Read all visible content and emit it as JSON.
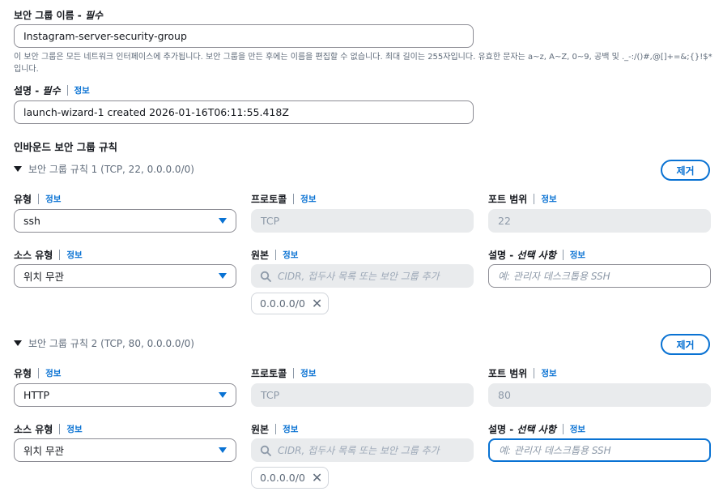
{
  "sg_name": {
    "label": "보안 그룹 이름 - ",
    "required": "필수",
    "value": "Instagram-server-security-group",
    "hint": "이 보안 그룹은 모든 네트워크 인터페이스에 추가됩니다. 보안 그룹을 만든 후에는 이름을 편집할 수 없습니다. 최대 길이는 255자입니다. 유효한 문자는 a~z, A~Z, 0~9, 공백 및 ._-:/()#,@[]+=&;{}!$*입니다."
  },
  "description": {
    "label": "설명 - ",
    "required": "필수",
    "info": "정보",
    "value": "launch-wizard-1 created 2026-01-16T06:11:55.418Z"
  },
  "inbound_title": "인바운드 보안 그룹 규칙",
  "labels": {
    "type": "유형",
    "protocol": "프로토콜",
    "port_range": "포트 범위",
    "source_type": "소스 유형",
    "source": "원본",
    "desc_prefix": "설명 - ",
    "desc_optional": "선택 사항",
    "info": "정보",
    "remove": "제거"
  },
  "rules": [
    {
      "title": "보안 그룹 규칙 1 (TCP, 22, 0.0.0.0/0)",
      "type": "ssh",
      "protocol": "TCP",
      "port": "22",
      "source_type": "위치 무관",
      "source_placeholder": "CIDR, 접두사 목록 또는 보안 그룹 추가",
      "token": "0.0.0.0/0",
      "desc_placeholder": "예: 관리자 데스크톱용 SSH",
      "desc_focused": false
    },
    {
      "title": "보안 그룹 규칙 2 (TCP, 80, 0.0.0.0/0)",
      "type": "HTTP",
      "protocol": "TCP",
      "port": "80",
      "source_type": "위치 무관",
      "source_placeholder": "CIDR, 접두사 목록 또는 보안 그룹 추가",
      "token": "0.0.0.0/0",
      "desc_placeholder": "예: 관리자 데스크톱용 SSH",
      "desc_focused": true
    }
  ],
  "colors": {
    "accent": "#0972d3",
    "disabled_bg": "#e9ebed",
    "text": "#16191f",
    "muted": "#5f6b7a"
  },
  "icons": {
    "dropdown": "caret-down-icon",
    "search": "search-icon",
    "remove_token": "close-icon",
    "expand": "triangle-down-icon"
  }
}
